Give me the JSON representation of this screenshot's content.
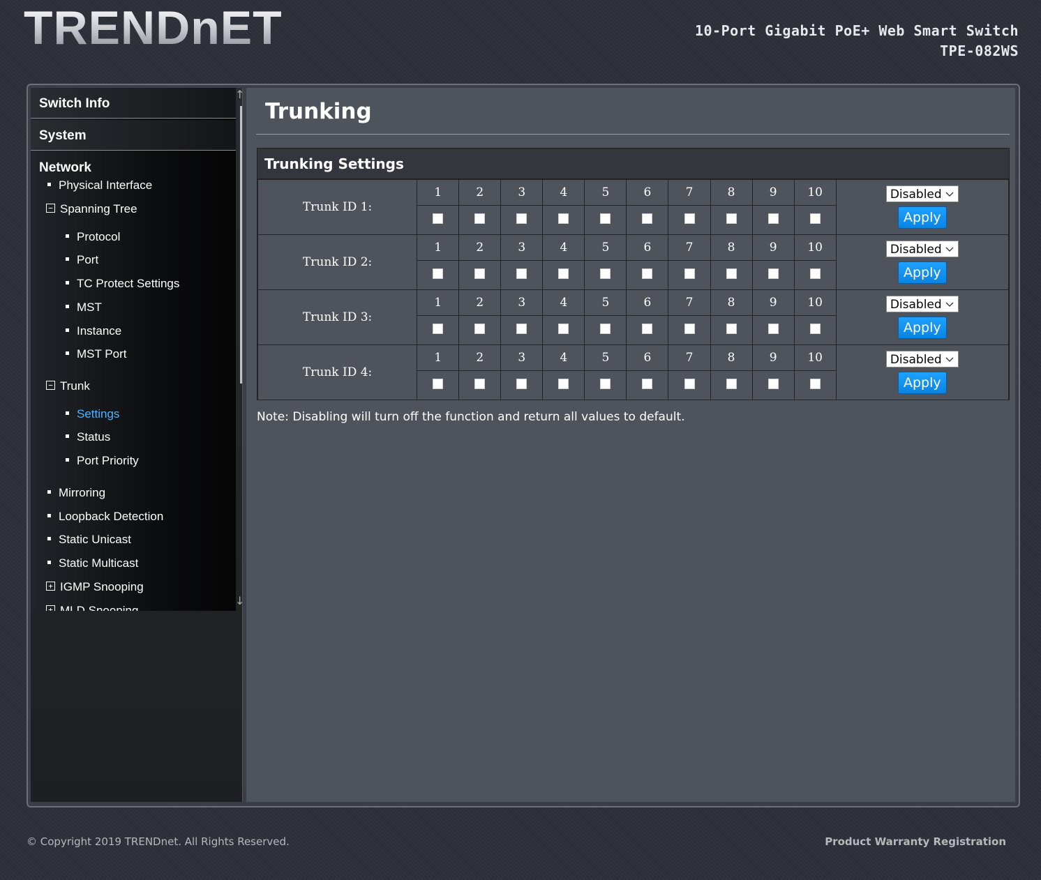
{
  "brand": {
    "logo_text": "TRENDnET"
  },
  "header": {
    "product_line": "10-Port Gigabit PoE+ Web Smart Switch",
    "model": "TPE-082WS"
  },
  "sidebar": {
    "headers": [
      "Switch Info",
      "System",
      "Network"
    ],
    "items": {
      "physical_interface": "Physical Interface",
      "spanning_tree": "Spanning Tree",
      "protocol": "Protocol",
      "port": "Port",
      "tc_protect": "TC Protect Settings",
      "mst": "MST",
      "instance": "Instance",
      "mst_port": "MST Port",
      "trunk": "Trunk",
      "settings": "Settings",
      "status": "Status",
      "port_priority": "Port Priority",
      "mirroring": "Mirroring",
      "loopback": "Loopback Detection",
      "static_unicast": "Static Unicast",
      "static_multicast": "Static Multicast",
      "igmp": "IGMP Snooping",
      "mld": "MLD Snooping"
    },
    "expander_minus": "−",
    "expander_plus": "+",
    "scroll_up": "↑",
    "scroll_down": "↓"
  },
  "main": {
    "page_title": "Trunking",
    "panel_title": "Trunking Settings",
    "ports": [
      "1",
      "2",
      "3",
      "4",
      "5",
      "6",
      "7",
      "8",
      "9",
      "10"
    ],
    "trunks": [
      {
        "label": "Trunk ID 1:",
        "state": "Disabled",
        "apply": "Apply"
      },
      {
        "label": "Trunk ID 2:",
        "state": "Disabled",
        "apply": "Apply"
      },
      {
        "label": "Trunk ID 3:",
        "state": "Disabled",
        "apply": "Apply"
      },
      {
        "label": "Trunk ID 4:",
        "state": "Disabled",
        "apply": "Apply"
      }
    ],
    "note": "Note: Disabling will turn off the function and return all values to default."
  },
  "footer": {
    "copyright": "© Copyright 2019 TRENDnet. All Rights Reserved.",
    "warranty": "Product Warranty Registration"
  },
  "colors": {
    "accent_link": "#4fb3ff",
    "button_blue": "#1ea2ff",
    "content_bg": "#4f535c"
  }
}
